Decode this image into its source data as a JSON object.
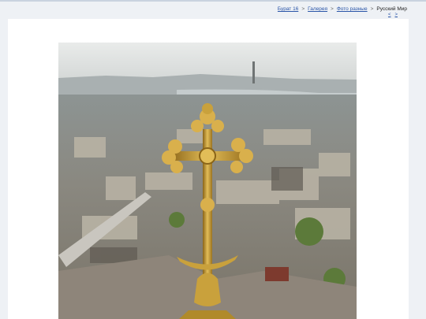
{
  "breadcrumb": {
    "items": [
      "Бурат 16",
      "Галерея",
      "Фото разные",
      "Русский Мир"
    ],
    "separator": ">"
  },
  "pager": {
    "prev": "<",
    "next": ">"
  },
  "photo": {
    "description_icon": "photo-image"
  },
  "colors": {
    "link": "#2a55a8",
    "page_bg": "#eef1f5",
    "card_bg": "#ffffff",
    "gold": "#c9a13c"
  }
}
